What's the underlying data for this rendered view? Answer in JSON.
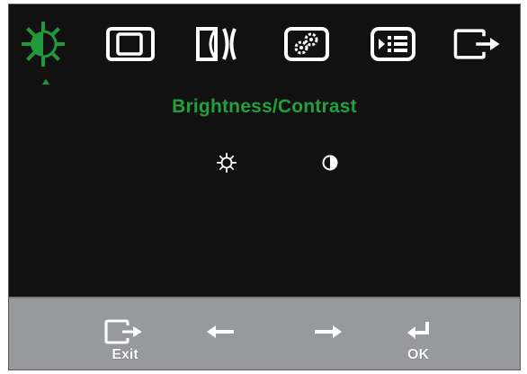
{
  "osd": {
    "tabs": [
      {
        "icon": "brightness-icon",
        "selected": true
      },
      {
        "icon": "image-position-icon",
        "selected": false
      },
      {
        "icon": "image-setup-icon",
        "selected": false
      },
      {
        "icon": "image-properties-icon",
        "selected": false
      },
      {
        "icon": "options-icon",
        "selected": false
      },
      {
        "icon": "exit-icon",
        "selected": false
      }
    ],
    "title": "Brightness/Contrast",
    "submenu": [
      {
        "icon": "brightness-icon"
      },
      {
        "icon": "contrast-icon"
      }
    ],
    "buttons": [
      {
        "icon": "exit-icon",
        "label": "Exit"
      },
      {
        "icon": "left-arrow-icon",
        "label": ""
      },
      {
        "icon": "right-arrow-icon",
        "label": ""
      },
      {
        "icon": "enter-icon",
        "label": "OK"
      }
    ],
    "colors": {
      "accent": "#21a13c",
      "background": "#111111",
      "bar": "#97999c",
      "icon": "#ffffff"
    }
  }
}
